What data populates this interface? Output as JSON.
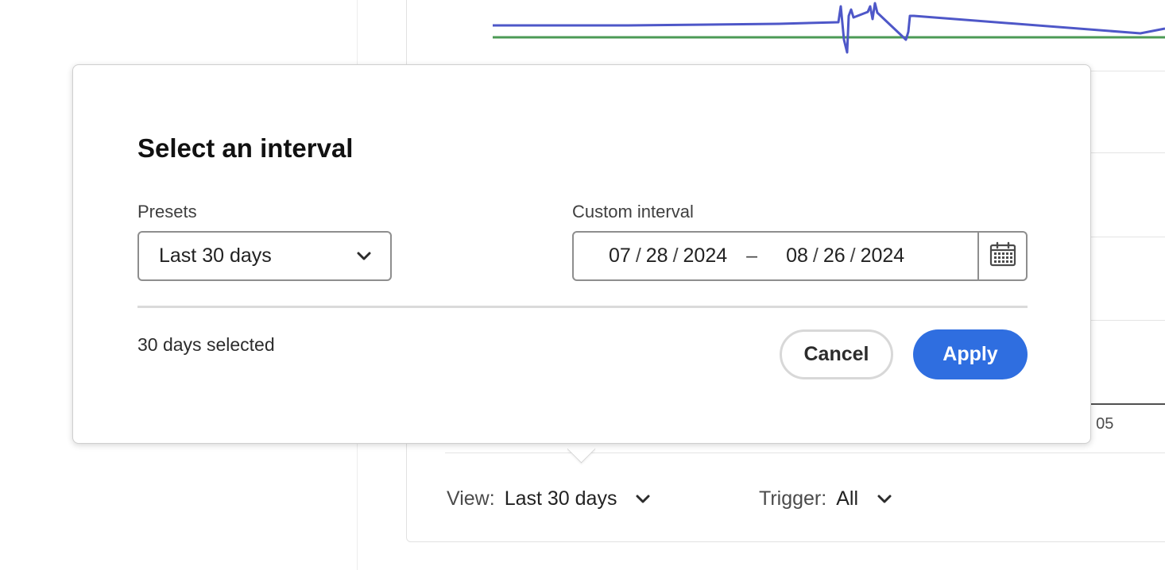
{
  "background": {
    "view_filter": {
      "label": "View:",
      "value": "Last 30 days"
    },
    "trigger_filter": {
      "label": "Trigger:",
      "value": "All"
    },
    "axis_tick_fragment": "; 05",
    "series_colors": {
      "primary": "#4e57c8",
      "secondary": "#4c9a55"
    }
  },
  "dialog": {
    "title": "Select an interval",
    "presets_label": "Presets",
    "preset_value": "Last 30 days",
    "custom_label": "Custom interval",
    "range": {
      "start": {
        "month": "07",
        "day": "28",
        "year": "2024"
      },
      "end": {
        "month": "08",
        "day": "26",
        "year": "2024"
      },
      "date_separator": "/",
      "range_separator": "–"
    },
    "selected_count": "30 days selected",
    "cancel_label": "Cancel",
    "apply_label": "Apply"
  },
  "colors": {
    "accent": "#2f6ee0",
    "border": "#8e8e8e",
    "divider": "#dadada"
  },
  "icons": {
    "preset_dropdown": "chevron-down-icon",
    "calendar": "calendar-icon",
    "view_dropdown": "chevron-down-icon",
    "trigger_dropdown": "chevron-down-icon"
  }
}
